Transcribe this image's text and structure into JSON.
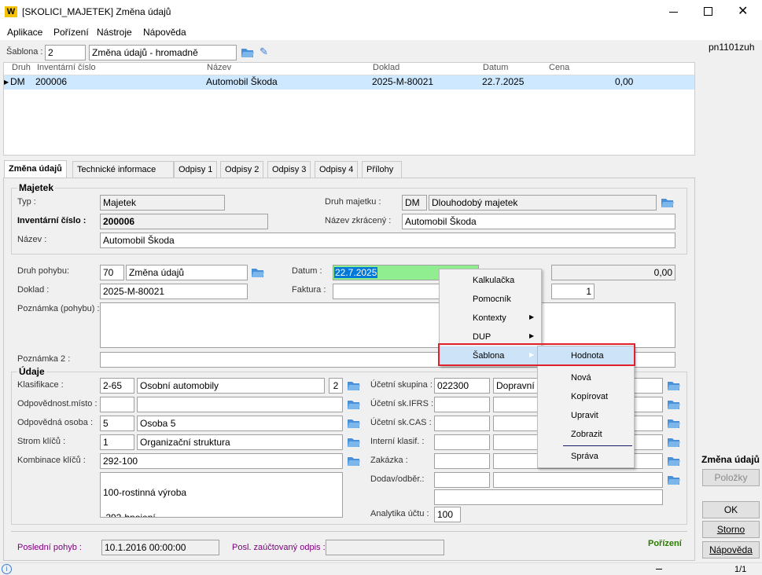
{
  "window": {
    "title": "[SKOLICI_MAJETEK] Změna údajů",
    "app_logo": "W"
  },
  "menu": [
    "Aplikace",
    "Pořízení",
    "Nástroje",
    "Nápověda"
  ],
  "user": "pn1101zuh",
  "sablona": {
    "label": "Šablona :",
    "number": "2",
    "name": "Změna údajů - hromadně"
  },
  "grid": {
    "headers": [
      "Druh",
      "Inventární číslo",
      "Název",
      "Doklad",
      "Datum",
      "Cena"
    ],
    "rows": [
      {
        "druh": "DM",
        "inv": "200006",
        "nazev": "Automobil Škoda",
        "doklad": "2025-M-80021",
        "datum": "22.7.2025",
        "cena": "0,00"
      }
    ]
  },
  "tabs": [
    "Změna údajů",
    "Technické informace",
    "Odpisy 1",
    "Odpisy 2",
    "Odpisy 3",
    "Odpisy 4",
    "Přílohy"
  ],
  "majetek": {
    "legend": "Majetek",
    "typ_label": "Typ :",
    "typ": "Majetek",
    "inv_label": "Inventární číslo :",
    "inv": "200006",
    "nazev_label": "Název :",
    "nazev": "Automobil Škoda",
    "druh_label": "Druh majetku :",
    "druh_code": "DM",
    "druh_name": "Dlouhodobý majetek",
    "zkraceny_label": "Název zkrácený :",
    "zkraceny": "Automobil Škoda"
  },
  "pohyb": {
    "druh_label": "Druh pohybu:",
    "druh_code": "70",
    "druh_name": "Změna údajů",
    "doklad_label": "Doklad :",
    "doklad": "2025-M-80021",
    "datum_label": "Datum :",
    "datum": "22.7.2025",
    "faktura_label": "Faktura :",
    "cena": "0,00",
    "pocet": "1",
    "poznamka_label": "Poznámka (pohybu) :",
    "poznamka2_label": "Poznámka 2 :"
  },
  "udaje": {
    "legend": "Údaje",
    "klas_label": "Klasifikace :",
    "klas_code": "2-65",
    "klas_name": "Osobní automobily",
    "klas_num": "2",
    "odpm_label": "Odpovědnost.místo :",
    "odpo_label": "Odpovědná osoba :",
    "odpo_code": "5",
    "odpo_name": "Osoba 5",
    "strom_label": "Strom klíčů :",
    "strom_code": "1",
    "strom_name": "Organizační struktura",
    "komb_label": "Kombinace klíčů :",
    "komb": "292-100",
    "komb_text": [
      "100-rostinná výroba",
      " 292-hnojení"
    ],
    "ucet_label": "Účetní skupina :",
    "ucet_code": "022300",
    "ucet_name": "Dopravní",
    "ifrs_label": "Účetní sk.IFRS :",
    "cas_label": "Účetní sk.CAS :",
    "interni_label": "Interní klasif. :",
    "zakazka_label": "Zakázka :",
    "dodav_label": "Dodav/odběr.:",
    "analyt_label": "Analytika účtu :",
    "analyt": "100"
  },
  "footer": {
    "posledni_label": "Poslední pohyb :",
    "posledni": "10.1.2016 00:00:00",
    "posl_odpis_label": "Posl. zaúčtovaný odpis :",
    "status": "Pořízení",
    "page": "1/1"
  },
  "right_panel": {
    "title": "Změna údajů",
    "polozky": "Položky",
    "ok": "OK",
    "storno": "Storno",
    "napoveda": "Nápověda"
  },
  "context_menu": {
    "items": [
      "Kalkulačka",
      "Pomocník",
      "Kontexty",
      "DUP",
      "Šablona"
    ]
  },
  "submenu": {
    "items": [
      "Hodnota",
      "Nová",
      "Kopírovat",
      "Upravit",
      "Zobrazit",
      "Správa"
    ]
  },
  "colors": {
    "selected_row": "#cde8ff",
    "date_field": "#90ee90",
    "highlight_border": "#e0202a",
    "status_green": "#2a7a00",
    "purple_label": "#800080"
  }
}
